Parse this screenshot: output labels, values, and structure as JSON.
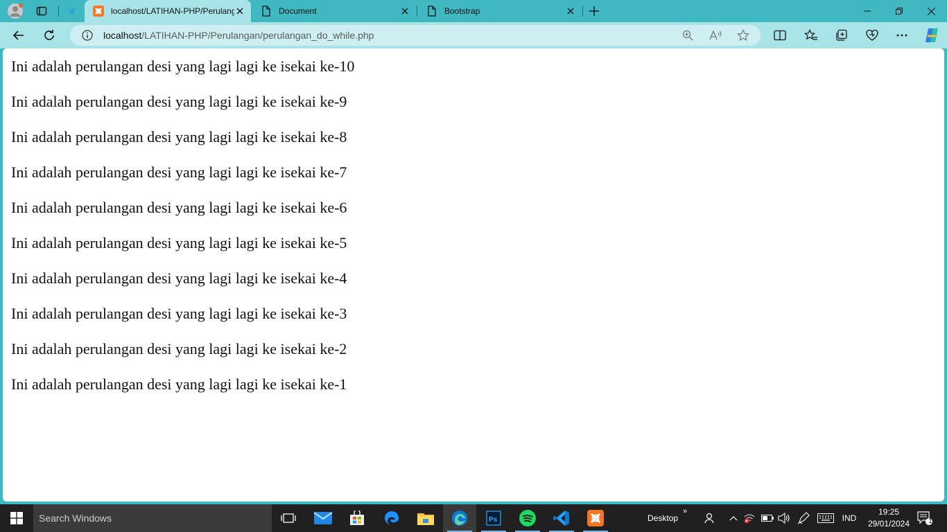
{
  "tabs": [
    {
      "title": "localhost/LATIHAN-PHP/Perulangan/perulangan_do_while.php",
      "active": true,
      "favicon": "xampp-icon"
    },
    {
      "title": "Document",
      "active": false,
      "favicon": "page-icon"
    },
    {
      "title": "Bootstrap",
      "active": false,
      "favicon": "page-icon"
    }
  ],
  "address_bar": {
    "url_host": "localhost",
    "url_path": "/LATIHAN-PHP/Perulangan/perulangan_do_while.php"
  },
  "content": {
    "lines": [
      "Ini adalah perulangan desi yang lagi lagi ke isekai ke-10",
      "Ini adalah perulangan desi yang lagi lagi ke isekai ke-9",
      "Ini adalah perulangan desi yang lagi lagi ke isekai ke-8",
      "Ini adalah perulangan desi yang lagi lagi ke isekai ke-7",
      "Ini adalah perulangan desi yang lagi lagi ke isekai ke-6",
      "Ini adalah perulangan desi yang lagi lagi ke isekai ke-5",
      "Ini adalah perulangan desi yang lagi lagi ke isekai ke-4",
      "Ini adalah perulangan desi yang lagi lagi ke isekai ke-3",
      "Ini adalah perulangan desi yang lagi lagi ke isekai ke-2",
      "Ini adalah perulangan desi yang lagi lagi ke isekai ke-1"
    ]
  },
  "taskbar": {
    "search_placeholder": "Search Windows",
    "desktop_label": "Desktop",
    "language": "IND",
    "time": "19:25",
    "date": "29/01/2024",
    "notification_count": "1"
  },
  "colors": {
    "browser_frame": "#3fb8c2",
    "toolbar": "#a8e4e7",
    "taskbar": "#202020"
  }
}
